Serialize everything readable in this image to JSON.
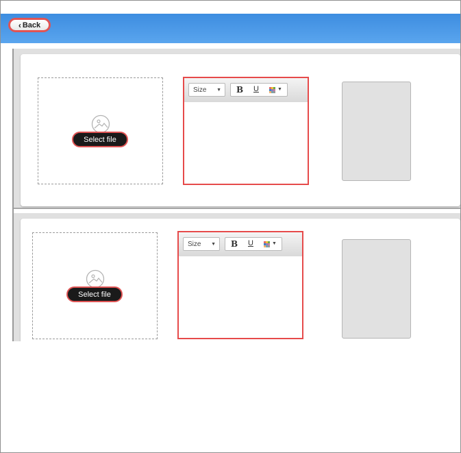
{
  "header": {
    "back_label": "Back",
    "accent_color": "#4a98e8"
  },
  "rows": [
    {
      "upload": {
        "button_label": "Select file",
        "icon": "image-placeholder-icon"
      },
      "editor": {
        "size_label": "Size",
        "bold_label": "B",
        "underline_label": "U",
        "icons": [
          "dropdown-caret-icon",
          "bold-icon",
          "underline-icon",
          "color-grid-icon"
        ]
      }
    },
    {
      "upload": {
        "button_label": "Select file",
        "icon": "image-placeholder-icon"
      },
      "editor": {
        "size_label": "Size",
        "bold_label": "B",
        "underline_label": "U",
        "icons": [
          "dropdown-caret-icon",
          "bold-icon",
          "underline-icon",
          "color-grid-icon"
        ]
      }
    }
  ]
}
